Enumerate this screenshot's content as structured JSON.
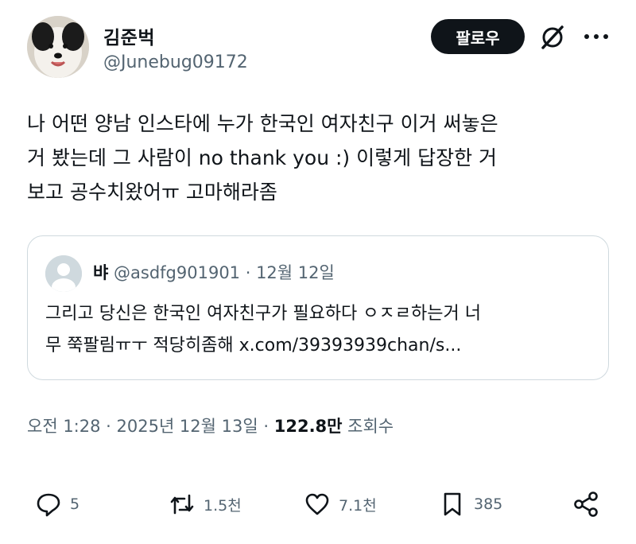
{
  "author": {
    "name": "김준벅",
    "handle": "@Junebug09172"
  },
  "header": {
    "follow_label": "팔로우"
  },
  "tweet": {
    "lines": [
      "나 어떤 양남 인스타에 누가 한국인 여자친구 이거 써놓은",
      "거 봤는데 그 사람이 no thank you :) 이렇게 답장한 거",
      "보고 공수치왔어ㅠ 고마해라좀"
    ]
  },
  "quote": {
    "name": "뱌",
    "meta": "@asdfg901901 · 12월 12일",
    "lines": [
      "그리고 당신은 한국인 여자친구가 필요하다 ㅇㅈㄹ하는거 너",
      "무 쭉팔림ㅠㅜ 적당히좀해 x.com/39393939chan/s..."
    ]
  },
  "meta": {
    "timestamp": "오전 1:28 · 2025년 12월 13일 · ",
    "views": "122.8만",
    "views_label": " 조회수"
  },
  "actions": {
    "replies": "5",
    "retweets": "1.5천",
    "likes": "7.1천",
    "bookmarks": "385"
  },
  "icons": [
    "grok-icon",
    "more-icon",
    "reply-icon",
    "retweet-icon",
    "like-icon",
    "bookmark-icon",
    "share-icon"
  ]
}
